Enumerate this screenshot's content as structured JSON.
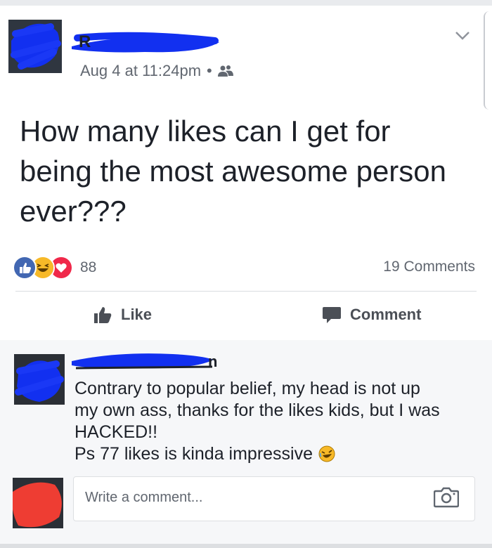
{
  "post": {
    "author": "R",
    "timestamp": "Aug 4 at 11:24pm",
    "separator": "•",
    "audience_icon": "friends-icon",
    "text": "How many likes can I get for being the most awesome person ever???",
    "reactions": [
      "like",
      "haha",
      "love"
    ],
    "reaction_count": "88",
    "comments_count": "19 Comments"
  },
  "actions": {
    "like_label": "Like",
    "comment_label": "Comment"
  },
  "comment": {
    "author": "n",
    "lines": [
      "Contrary to popular belief, my head is not up",
      "my own ass, thanks for the likes kids, but I was",
      "HACKED!!",
      "Ps 77 likes is kinda impressive"
    ],
    "emoji": "rolling-laughing-emoji"
  },
  "composer": {
    "placeholder": "Write a comment..."
  },
  "colors": {
    "like_blue": "#4267b2",
    "haha_yellow": "#f7b928",
    "love_red": "#f0284a",
    "redaction_blue": "#1230f0",
    "redaction_red": "#ee3d33"
  }
}
